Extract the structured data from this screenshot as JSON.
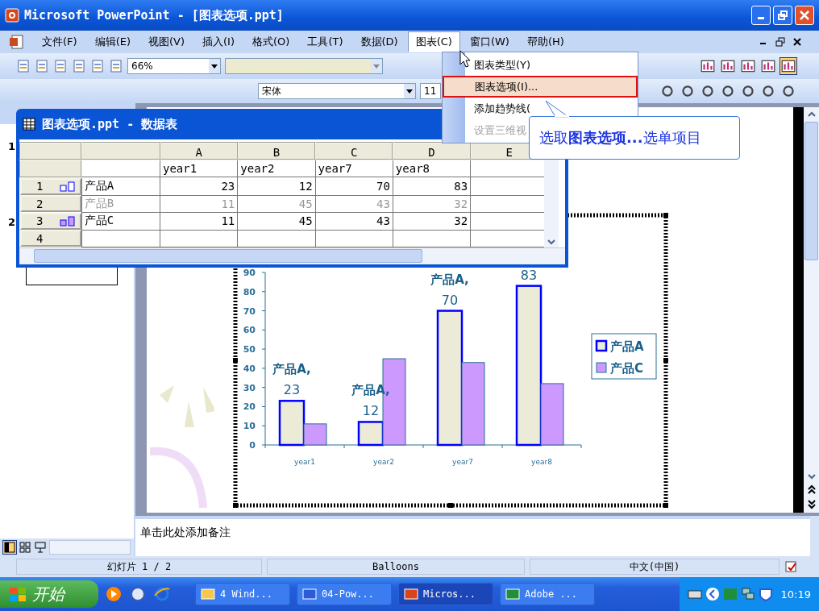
{
  "window": {
    "title": "Microsoft PowerPoint - [图表选项.ppt]"
  },
  "menu": [
    {
      "label": "文件(F)",
      "selected": false
    },
    {
      "label": "编辑(E)",
      "selected": false
    },
    {
      "label": "视图(V)",
      "selected": false
    },
    {
      "label": "插入(I)",
      "selected": false
    },
    {
      "label": "格式(O)",
      "selected": false
    },
    {
      "label": "工具(T)",
      "selected": false
    },
    {
      "label": "数据(D)",
      "selected": false
    },
    {
      "label": "图表(C)",
      "selected": true
    },
    {
      "label": "窗口(W)",
      "selected": false
    },
    {
      "label": "帮助(H)",
      "selected": false
    }
  ],
  "toolbar": {
    "zoom": "66%",
    "font": "宋体",
    "font_size": "11"
  },
  "chart_menu": [
    {
      "label": "图表类型(Y)",
      "highlighted": false,
      "disabled": false
    },
    {
      "label": "图表选项(I)...",
      "highlighted": true,
      "disabled": false
    },
    {
      "label": "添加趋势线(",
      "highlighted": false,
      "disabled": false
    },
    {
      "label": "设置三维视",
      "highlighted": false,
      "disabled": true
    }
  ],
  "callout": {
    "text": "选取**图表选项...**选单项目"
  },
  "datasheet": {
    "title": "图表选项.ppt - 数据表",
    "columns": [
      "A",
      "B",
      "C",
      "D",
      "E"
    ],
    "categories": [
      "year1",
      "year2",
      "year7",
      "year8"
    ],
    "rows": [
      {
        "number": "1",
        "name": "产品A",
        "values": [
          "23",
          "12",
          "70",
          "83"
        ],
        "excluded": false,
        "color": "#ffffff"
      },
      {
        "number": "2",
        "name": "产品B",
        "values": [
          "11",
          "45",
          "43",
          "32"
        ],
        "excluded": true
      },
      {
        "number": "3",
        "name": "产品C",
        "values": [
          "11",
          "45",
          "43",
          "32"
        ],
        "excluded": false,
        "color": "#cc99ff"
      },
      {
        "number": "4"
      }
    ]
  },
  "slides": [
    {
      "number": "1",
      "kind": "number"
    },
    {
      "number": "2",
      "kind": "thumbnail"
    }
  ],
  "chart_data": {
    "type": "bar",
    "categories": [
      "year1",
      "year2",
      "year7",
      "year8"
    ],
    "series": [
      {
        "name": "产品A",
        "color": "#ecebd8",
        "values": [
          23,
          12,
          70,
          83
        ]
      },
      {
        "name": "产品C",
        "color": "#cc99ff",
        "values": [
          11,
          45,
          43,
          32
        ]
      }
    ],
    "legend": "right",
    "ylim": [
      0,
      90
    ],
    "yticks": [
      0,
      10,
      20,
      30,
      40,
      50,
      60,
      70,
      80,
      90
    ],
    "annotations": [
      {
        "x": "year1",
        "y": 23,
        "text": "产品A,"
      },
      {
        "x": "year1",
        "y": 23,
        "text": "23"
      },
      {
        "x": "year2",
        "y": 12,
        "text": "产品A,"
      },
      {
        "x": "year2",
        "y": 12,
        "text": "12"
      },
      {
        "x": "year7",
        "y": 70,
        "text": "产品A,"
      },
      {
        "x": "year7",
        "y": 70,
        "text": "70"
      },
      {
        "x": "year8",
        "y": 83,
        "text": "83"
      }
    ]
  },
  "notes": {
    "placeholder": "单击此处添加备注"
  },
  "status_bar": [
    "幻灯片 1 / 2",
    "Balloons",
    "中文(中国)"
  ],
  "taskbar": {
    "start": "开始",
    "tasks": [
      {
        "label": "4 Wind...",
        "selected": false,
        "kind": "folder"
      },
      {
        "label": "04-Pow...",
        "selected": false,
        "kind": "word"
      },
      {
        "label": "Micros...",
        "selected": true,
        "kind": "powerpoint"
      },
      {
        "label": "Adobe ...",
        "selected": false,
        "kind": "captivate"
      }
    ],
    "clock": "10:19"
  }
}
